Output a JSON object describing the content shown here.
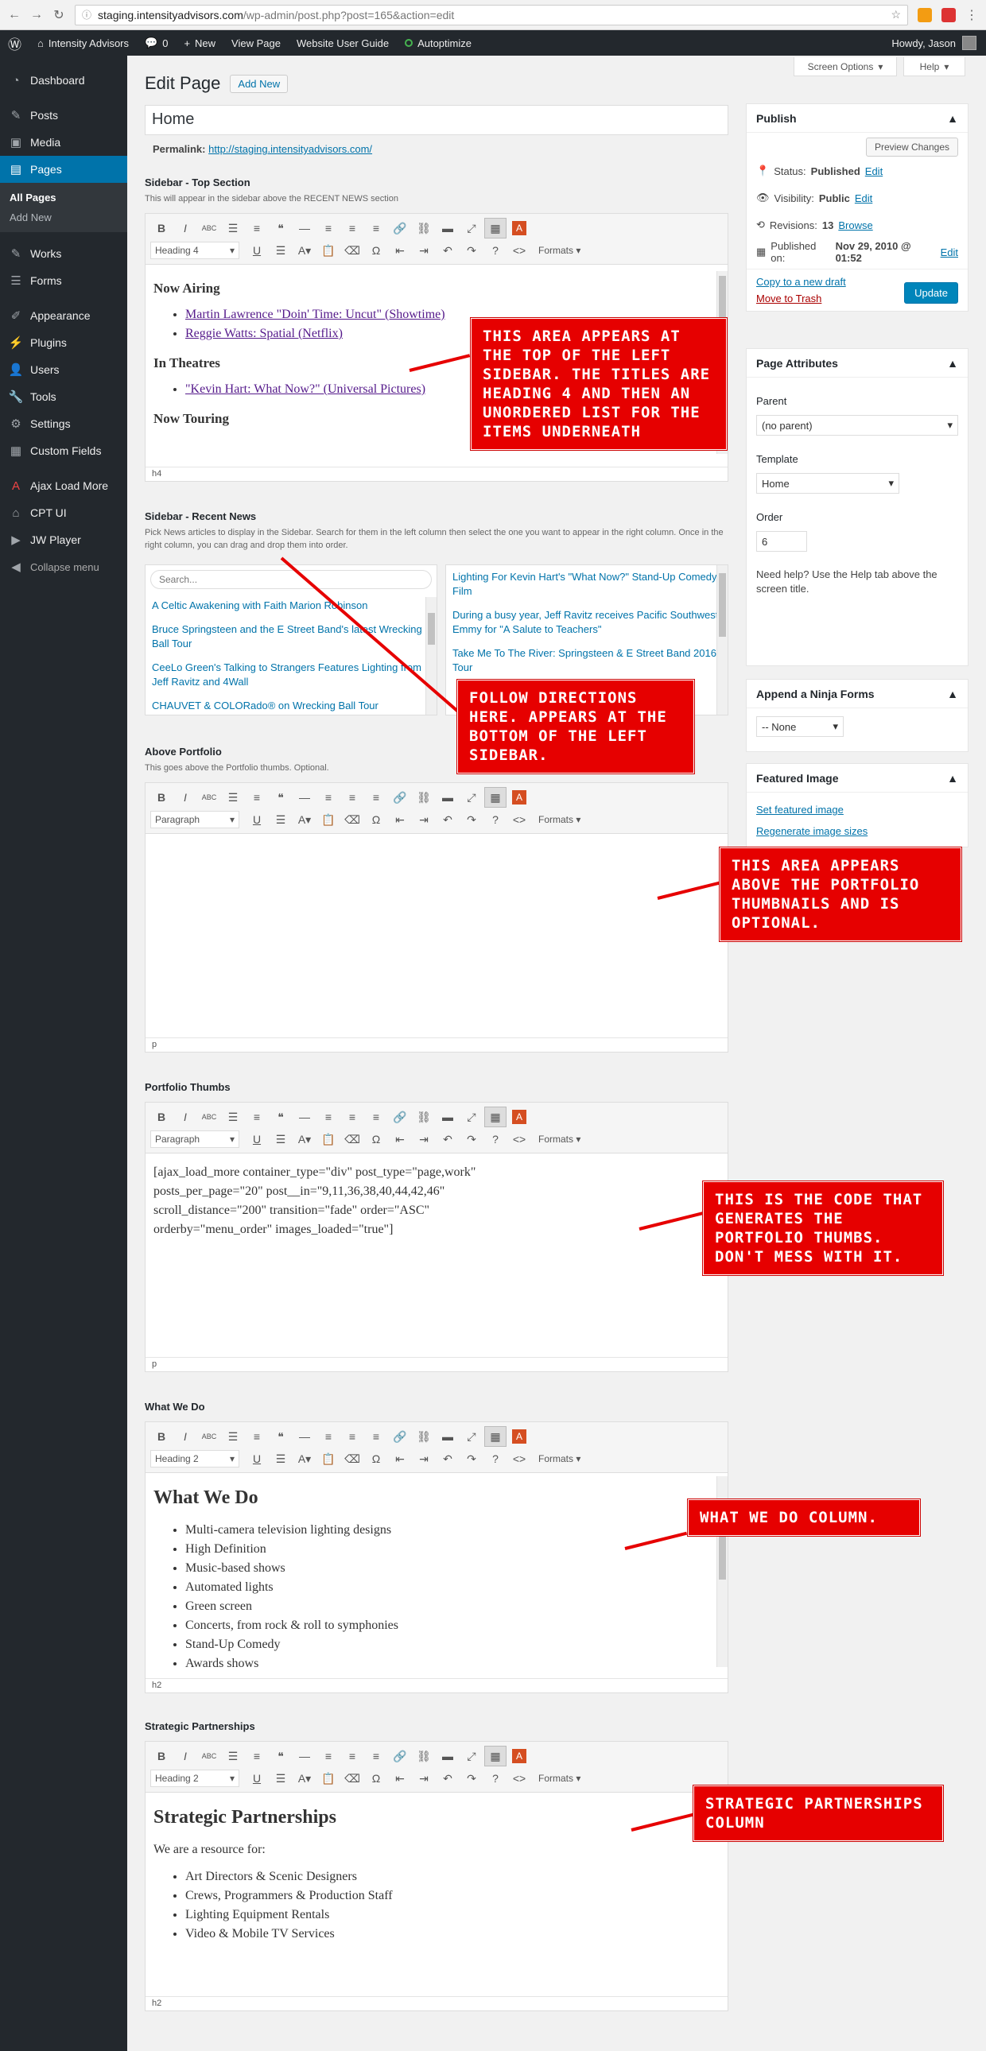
{
  "browser": {
    "host": "staging.intensityadvisors.com",
    "path": "/wp-admin/post.php?post=165&action=edit"
  },
  "adminbar": {
    "site": "Intensity Advisors",
    "comments": "0",
    "new": "New",
    "view_page": "View Page",
    "guide": "Website User Guide",
    "autoptimize": "Autoptimize",
    "howdy": "Howdy, Jason"
  },
  "sidebar": {
    "items": [
      {
        "label": "Dashboard",
        "icon": "dashboard-icon"
      },
      {
        "label": "Posts",
        "icon": "pin-icon"
      },
      {
        "label": "Media",
        "icon": "media-icon"
      },
      {
        "label": "Pages",
        "icon": "pages-icon"
      },
      {
        "label": "Works",
        "icon": "pin-icon"
      },
      {
        "label": "Forms",
        "icon": "forms-icon"
      },
      {
        "label": "Appearance",
        "icon": "brush-icon"
      },
      {
        "label": "Plugins",
        "icon": "plug-icon"
      },
      {
        "label": "Users",
        "icon": "user-icon"
      },
      {
        "label": "Tools",
        "icon": "wrench-icon"
      },
      {
        "label": "Settings",
        "icon": "settings-icon"
      },
      {
        "label": "Custom Fields",
        "icon": "fields-icon"
      },
      {
        "label": "Ajax Load More",
        "icon": "ajax-icon"
      },
      {
        "label": "CPT UI",
        "icon": "cpt-icon"
      },
      {
        "label": "JW Player",
        "icon": "player-icon"
      },
      {
        "label": "Collapse menu",
        "icon": "collapse-icon"
      }
    ],
    "sub": {
      "all_pages": "All Pages",
      "add_new": "Add New"
    }
  },
  "header": {
    "screen_options": "Screen Options",
    "help": "Help",
    "title": "Edit Page",
    "add_new": "Add New"
  },
  "post": {
    "title": "Home",
    "permalink_label": "Permalink:",
    "permalink_url": "http://staging.intensityadvisors.com/"
  },
  "editor": {
    "formats": "Formats"
  },
  "sections": {
    "top": {
      "title": "Sidebar - Top Section",
      "desc": "This will appear in the sidebar above the RECENT NEWS section",
      "format": "Heading 4",
      "status": "h4",
      "h_now_airing": "Now Airing",
      "now_airing": [
        "Martin Lawrence \"Doin' Time: Uncut\" (Showtime)",
        "Reggie Watts: Spatial (Netflix)"
      ],
      "h_theatres": "In Theatres",
      "theatres": [
        "\"Kevin Hart: What Now?\" (Universal Pictures)"
      ],
      "h_touring": "Now Touring"
    },
    "news": {
      "title": "Sidebar - Recent News",
      "desc": "Pick News articles to display in the Sidebar. Search for them in the left column then select the one you want to appear in the right column. Once in the right column, you can drag and drop them into order.",
      "search": "Search...",
      "left": [
        "A Celtic Awakening with Faith Marion Robinson",
        "Bruce Springsteen and the E Street Band's latest Wrecking Ball Tour",
        "CeeLo Green's Talking to Strangers Features Lighting from Jeff Ravitz and 4Wall",
        "CHAUVET & COLORado® on Wrecking Ball Tour"
      ],
      "right": [
        "Lighting For Kevin Hart's \"What Now?\" Stand-Up Comedy Film",
        "During a busy year, Jeff Ravitz receives Pacific Southwest Emmy for \"A Salute to Teachers\"",
        "Take Me To The River: Springsteen & E Street Band 2016 Tour"
      ]
    },
    "above": {
      "title": "Above Portfolio",
      "desc": "This goes above the Portfolio thumbs. Optional.",
      "format": "Paragraph",
      "status": "p"
    },
    "thumbs": {
      "title": "Portfolio Thumbs",
      "format": "Paragraph",
      "status": "p",
      "code": "[ajax_load_more container_type=\"div\" post_type=\"page,work\" posts_per_page=\"20\" post__in=\"9,11,36,38,40,44,42,46\" scroll_distance=\"200\" transition=\"fade\" order=\"ASC\" orderby=\"menu_order\" images_loaded=\"true\"]"
    },
    "whatwedo": {
      "title": "What We Do",
      "format": "Heading 2",
      "status": "h2",
      "heading": "What We Do",
      "items": [
        "Multi-camera television lighting designs",
        "High Definition",
        "Music-based shows",
        "Automated lights",
        "Green screen",
        "Concerts, from rock & roll to symphonies",
        "Stand-Up Comedy",
        "Awards shows"
      ]
    },
    "strategic": {
      "title": "Strategic Partnerships",
      "format": "Heading 2",
      "status": "h2",
      "heading": "Strategic Partnerships",
      "intro": "We are a resource for:",
      "items": [
        "Art Directors & Scenic Designers",
        "Crews, Programmers & Production Staff",
        "Lighting Equipment Rentals",
        "Video & Mobile TV Services"
      ]
    }
  },
  "publish": {
    "title": "Publish",
    "preview": "Preview Changes",
    "status_label": "Status:",
    "status_value": "Published",
    "visibility_label": "Visibility:",
    "visibility_value": "Public",
    "revisions_label": "Revisions:",
    "revisions_value": "13",
    "browse": "Browse",
    "published_label": "Published on:",
    "published_value": "Nov 29, 2010 @ 01:52",
    "edit": "Edit",
    "copy_draft": "Copy to a new draft",
    "trash": "Move to Trash",
    "update": "Update"
  },
  "attributes": {
    "title": "Page Attributes",
    "parent_label": "Parent",
    "parent_value": "(no parent)",
    "template_label": "Template",
    "template_value": "Home",
    "order_label": "Order",
    "order_value": "6",
    "help": "Need help? Use the Help tab above the screen title."
  },
  "ninja": {
    "title": "Append a Ninja Forms",
    "value": "-- None"
  },
  "featured": {
    "title": "Featured Image",
    "set": "Set featured image",
    "regen": "Regenerate image sizes"
  },
  "callouts": {
    "c1": "This area appears at the top of the left sidebar. The titles are Heading 4 and then an unordered list for the items underneath",
    "c2": "Follow directions here. Appears at the bottom of the left sidebar.",
    "c3": "This area appears above the portfolio thumbnails and is optional.",
    "c4": "This is the code that generates the portfolio thumbs. Don't mess with it.",
    "c5": "What We Do column.",
    "c6": "Strategic Partnerships column"
  },
  "colors": {
    "sidebar": "#23282d",
    "active": "#0073aa",
    "callout": "#e60000"
  }
}
